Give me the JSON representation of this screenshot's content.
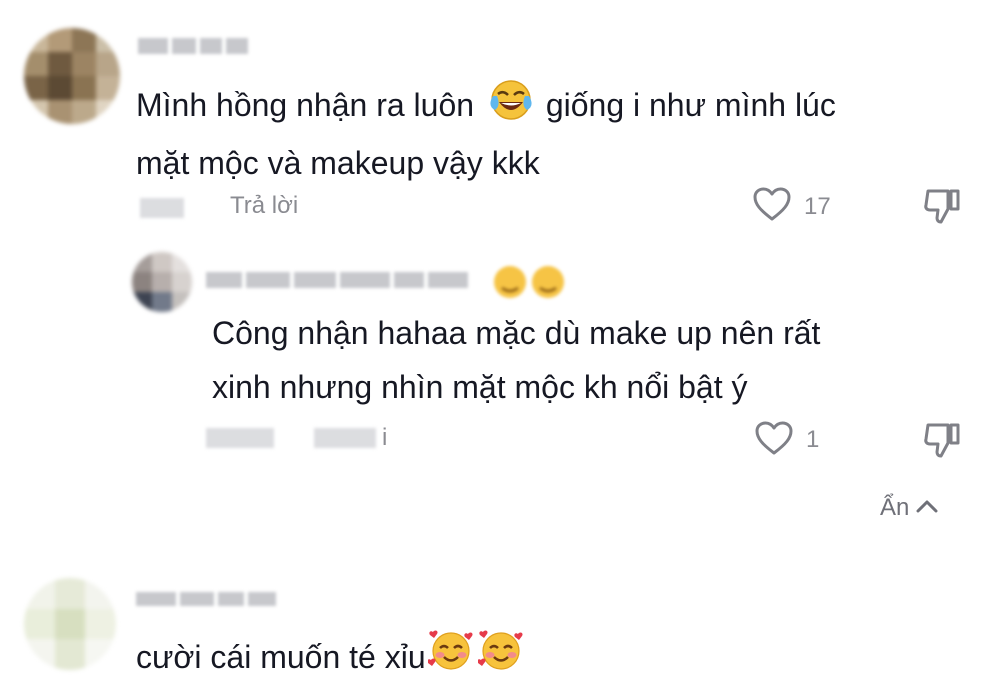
{
  "comments": [
    {
      "text_line1": "Mình hồng nhận ra luôn",
      "text_line1b": "giống i như mình lúc",
      "text_line2": "mặt mộc và makeup vậy kkk",
      "reply_label": "Trả lời",
      "like_count": "17",
      "emoji_inline": "face-with-tears-of-joy"
    },
    {
      "text_line1": "Công nhận hahaa mặc dù make up nên rất",
      "text_line2": "xinh nhưng nhìn mặt mộc kh nổi bật ý",
      "reply_suffix": "i",
      "like_count": "1"
    },
    {
      "text": "cười cái muốn té xỉu",
      "emojis": [
        "smiling-face-with-hearts",
        "smiling-face-with-hearts"
      ]
    }
  ],
  "hide_replies_label": "Ẩn",
  "colors": {
    "text": "#161823",
    "meta": "#8a8b91",
    "blur": "#c7c8cc"
  }
}
